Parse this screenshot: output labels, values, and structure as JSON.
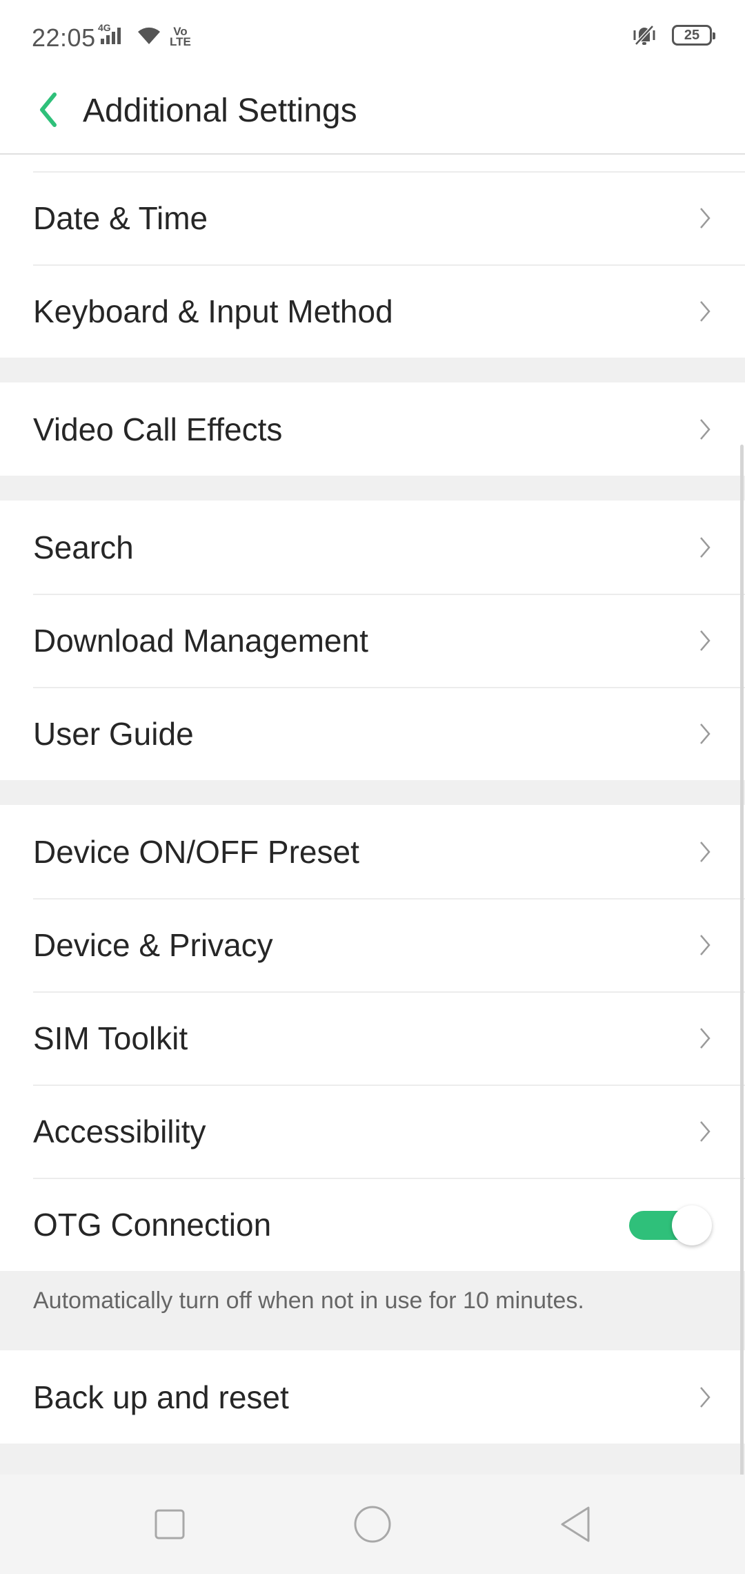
{
  "status_bar": {
    "time": "22:05",
    "network_label": "4G",
    "volte_line1": "Vo",
    "volte_line2": "LTE",
    "battery": "25",
    "icons": [
      "signal-icon",
      "wifi-icon",
      "vibrate-icon",
      "battery-icon"
    ]
  },
  "header": {
    "title": "Additional Settings",
    "back_icon": "chevron-left-icon"
  },
  "groups": [
    {
      "items": [
        {
          "label": "Date & Time",
          "control": "chevron"
        },
        {
          "label": "Keyboard & Input Method",
          "control": "chevron"
        }
      ]
    },
    {
      "items": [
        {
          "label": "Video Call Effects",
          "control": "chevron"
        }
      ]
    },
    {
      "items": [
        {
          "label": "Search",
          "control": "chevron"
        },
        {
          "label": "Download Management",
          "control": "chevron"
        },
        {
          "label": "User Guide",
          "control": "chevron"
        }
      ]
    },
    {
      "items": [
        {
          "label": "Device ON/OFF Preset",
          "control": "chevron"
        },
        {
          "label": "Device & Privacy",
          "control": "chevron"
        },
        {
          "label": "SIM Toolkit",
          "control": "chevron"
        },
        {
          "label": "Accessibility",
          "control": "chevron"
        },
        {
          "label": "OTG Connection",
          "control": "toggle",
          "toggle_on": true
        }
      ],
      "note": "Automatically turn off when not in use for 10 minutes."
    },
    {
      "items": [
        {
          "label": "Back up and reset",
          "control": "chevron"
        }
      ]
    }
  ],
  "nav_bar": {
    "buttons": [
      "recent-apps-button",
      "home-button",
      "back-button"
    ]
  },
  "colors": {
    "accent": "#2fc07a",
    "background": "#f0f0f0",
    "surface": "#ffffff",
    "text": "#262626"
  }
}
